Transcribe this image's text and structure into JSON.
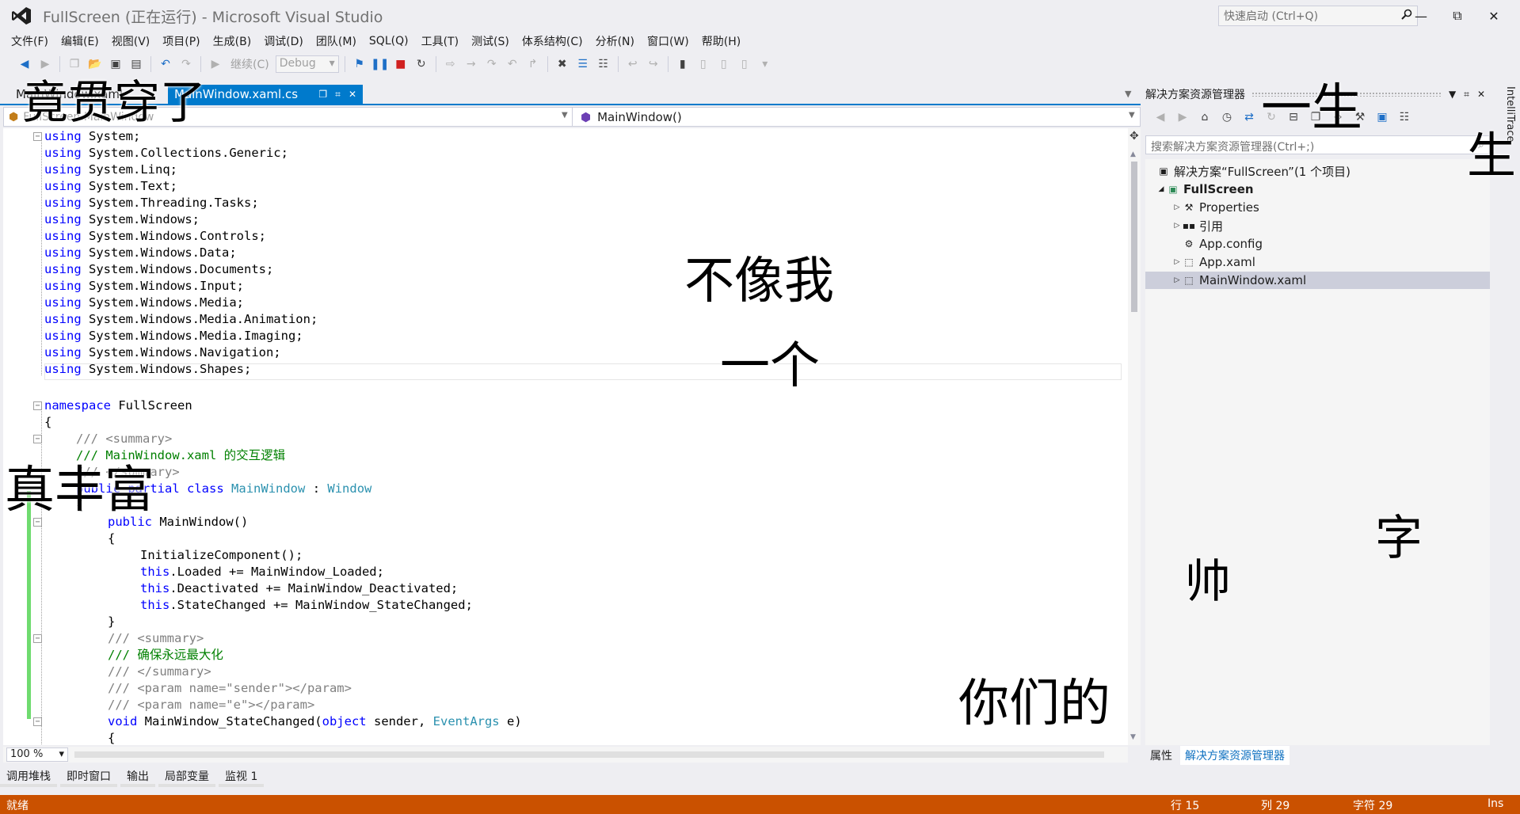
{
  "window": {
    "title": "FullScreen (正在运行) - Microsoft Visual Studio",
    "quick_launch_placeholder": "快速启动 (Ctrl+Q)"
  },
  "menu": [
    "文件(F)",
    "编辑(E)",
    "视图(V)",
    "项目(P)",
    "生成(B)",
    "调试(D)",
    "团队(M)",
    "SQL(Q)",
    "工具(T)",
    "测试(S)",
    "体系结构(C)",
    "分析(N)",
    "窗口(W)",
    "帮助(H)"
  ],
  "toolbar": {
    "continue_label": "继续(C)",
    "config_value": "Debug"
  },
  "tabs": {
    "inactive_label": "MainWindow.xaml",
    "active_label": "MainWindow.xaml.cs"
  },
  "navbar": {
    "left_value": "FullScreen.MainWindow",
    "right_value": "MainWindow()"
  },
  "code": {
    "using_lines": [
      "System;",
      "System.Collections.Generic;",
      "System.Linq;",
      "System.Text;",
      "System.Threading.Tasks;",
      "System.Windows;",
      "System.Windows.Controls;",
      "System.Windows.Data;",
      "System.Windows.Documents;",
      "System.Windows.Input;",
      "System.Windows.Media;",
      "System.Windows.Media.Animation;",
      "System.Windows.Media.Imaging;",
      "System.Windows.Navigation;",
      "System.Windows.Shapes;"
    ],
    "using_kw": "using",
    "namespace_kw": "namespace",
    "namespace_name": "FullScreen",
    "open_brace": "{",
    "close_brace": "}",
    "summary_open": "/// <summary>",
    "summary_close": "/// </summary>",
    "class_comment": "/// MainWindow.xaml 的交互逻辑",
    "class_kw1": "public",
    "class_kw2": "partial",
    "class_kw3": "class",
    "class_name": "MainWindow",
    "class_colon": ":",
    "class_base": "Window",
    "ctor_kw": "public",
    "ctor_name": "MainWindow()",
    "init_call": "InitializeComponent();",
    "this_kw": "this",
    "event1": ".Loaded += MainWindow_Loaded;",
    "event2": ".Deactivated += MainWindow_Deactivated;",
    "event3": ".StateChanged += MainWindow_StateChanged;",
    "method_comment": "/// 确保永远最大化",
    "param1": "/// <param name=\"sender\"></param>",
    "param2": "/// <param name=\"e\"></param>",
    "method_kw": "void",
    "method_name": "MainWindow_StateChanged(",
    "method_obj": "object",
    "method_sender": "sender,",
    "method_eventargs": "EventArgs",
    "method_e": "e)"
  },
  "zoom": "100 %",
  "bottom_tabs": [
    "调用堆栈",
    "即时窗口",
    "输出",
    "局部变量",
    "监视 1"
  ],
  "status": {
    "ready": "就绪",
    "line": "行 15",
    "col": "列 29",
    "char": "字符 29",
    "mode": "Ins"
  },
  "solution_explorer": {
    "title": "解决方案资源管理器",
    "search_placeholder": "搜索解决方案资源管理器(Ctrl+;)",
    "solution_label": "解决方案“FullScreen”(1 个项目)",
    "project": "FullScreen",
    "items": [
      "Properties",
      "引用",
      "App.config",
      "App.xaml",
      "MainWindow.xaml"
    ],
    "footer_tabs": [
      "属性",
      "解决方案资源管理器"
    ]
  },
  "right_vertical_tab": "IntelliTrace",
  "stickers": [
    "竟贯穿了",
    "一生",
    "生",
    "不像我",
    "一个",
    "真丰富",
    "字",
    "帅",
    "你们的"
  ],
  "colors": {
    "accent": "#007ACC",
    "status_bar": "#CA5100",
    "keyword": "#0000FF",
    "type": "#2B91AF",
    "comment": "#008000"
  }
}
